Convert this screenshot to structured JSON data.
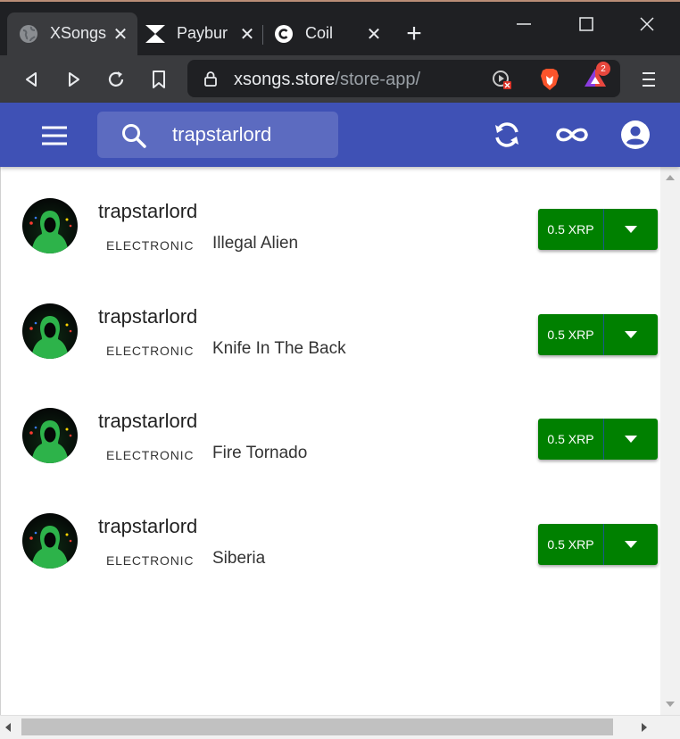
{
  "browser": {
    "tabs": [
      {
        "title": "XSongs",
        "favicon": "globe-icon",
        "active": true
      },
      {
        "title": "Payburn",
        "favicon": "payburn-logo-icon",
        "active": false
      },
      {
        "title": "Coil",
        "favicon": "coil-logo-icon",
        "active": false
      }
    ],
    "new_tab": "+",
    "url_domain": "xsongs.store",
    "url_path": "/store-app/",
    "extension_badge": "2"
  },
  "app": {
    "search_value": "trapstarlord",
    "accent_color": "#3f51b5",
    "buy_color": "#008000"
  },
  "songs": [
    {
      "artist": "trapstarlord",
      "genre": "ELECTRONIC",
      "title": "Illegal Alien",
      "price": "0.5 XRP"
    },
    {
      "artist": "trapstarlord",
      "genre": "ELECTRONIC",
      "title": "Knife In The Back",
      "price": "0.5 XRP"
    },
    {
      "artist": "trapstarlord",
      "genre": "ELECTRONIC",
      "title": "Fire Tornado",
      "price": "0.5 XRP"
    },
    {
      "artist": "trapstarlord",
      "genre": "ELECTRONIC",
      "title": "Siberia",
      "price": "0.5 XRP"
    }
  ]
}
